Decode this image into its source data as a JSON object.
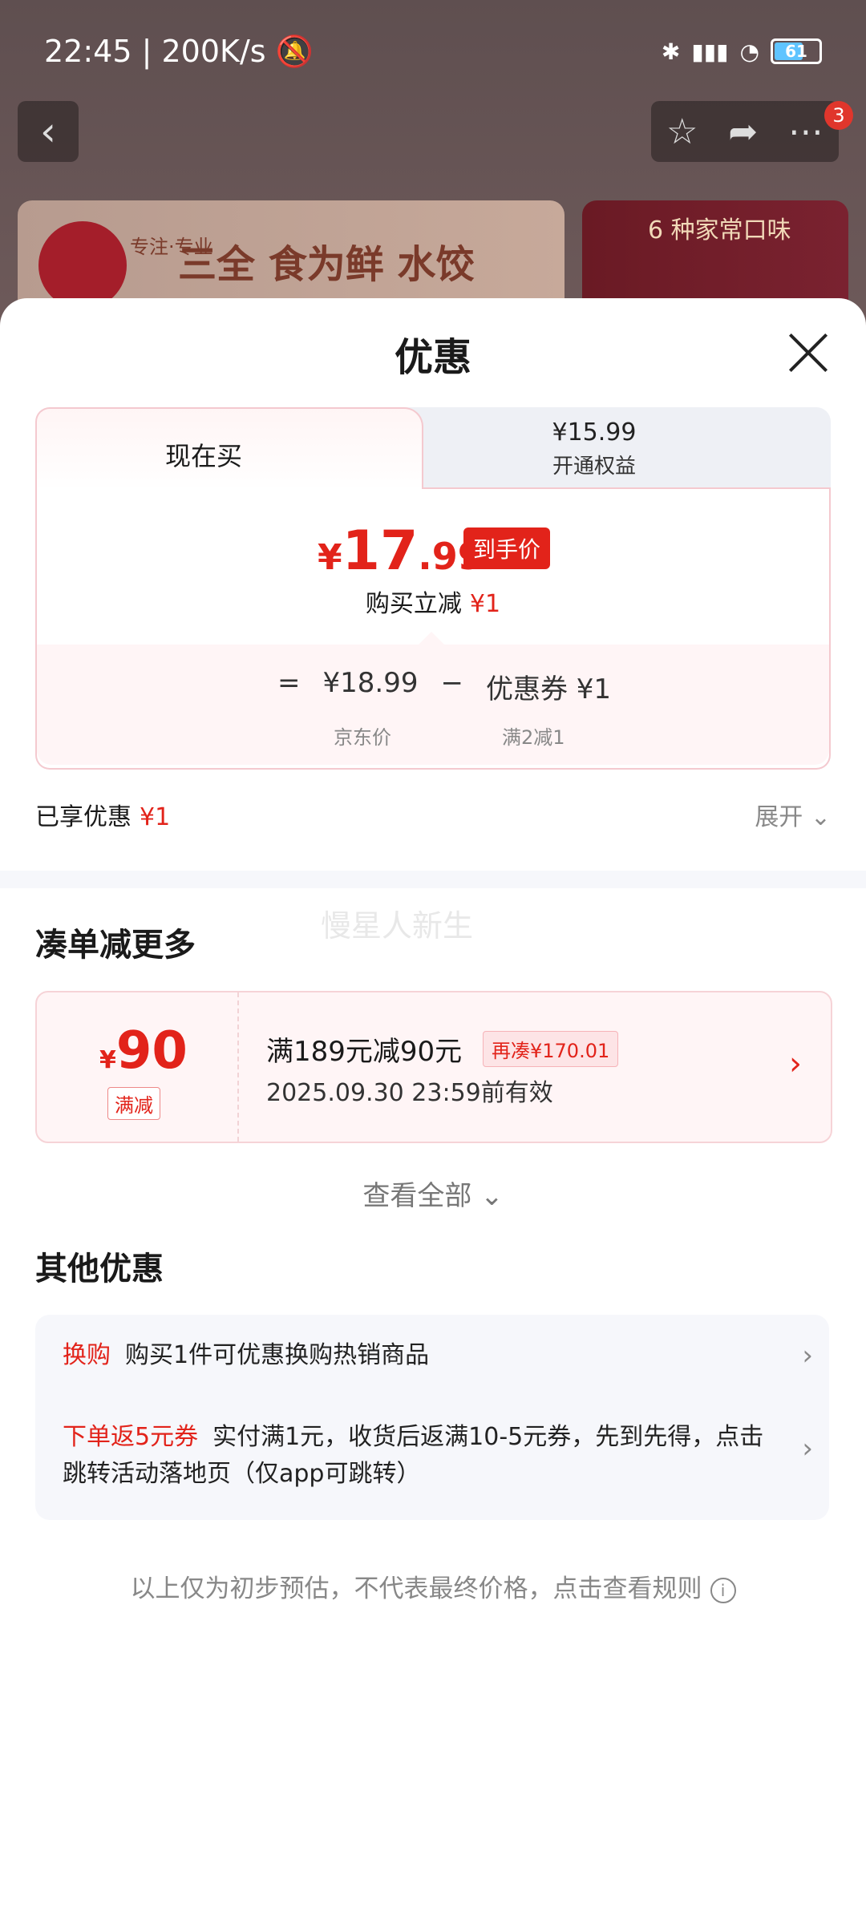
{
  "status_bar": {
    "time": "22:45",
    "speed": "200K/s",
    "battery": "61"
  },
  "background": {
    "banner1_text": "三全 食为鲜 水饺",
    "banner1_brand": "专注·专业",
    "banner2_text": "6 种家常口味",
    "nav_badge": "3"
  },
  "sheet": {
    "title": "优惠",
    "tab_now": "现在买",
    "tab_member_price": "¥15.99",
    "tab_member_label": "开通权益",
    "final_price_symbol": "¥",
    "final_price_int": "17",
    "final_price_dec": ".99",
    "final_price_tag": "到手价",
    "reduce_label": "购买立减",
    "reduce_value": "¥1",
    "calc_equals": "=",
    "calc_jd_price": "¥18.99",
    "calc_minus": "−",
    "calc_coupon": "优惠券 ¥1",
    "calc_jd_label": "京东价",
    "calc_coupon_label": "满2减1",
    "enjoyed_label": "已享优惠",
    "enjoyed_value": "¥1",
    "expand_label": "展开"
  },
  "more_section": {
    "title": "凑单减更多",
    "watermark": "慢星人新生",
    "coupon": {
      "symbol": "¥",
      "amount": "90",
      "type": "满减",
      "condition": "满189元减90元",
      "need_more": "再凑¥170.01",
      "valid": "2025.09.30 23:59前有效"
    },
    "view_all": "查看全部"
  },
  "other_section": {
    "title": "其他优惠",
    "rows": [
      {
        "tag": "换购",
        "text": "购买1件可优惠换购热销商品"
      },
      {
        "tag": "下单返5元券",
        "text": "实付满1元，收货后返满10-5元券，先到先得，点击跳转活动落地页（仅app可跳转）"
      }
    ]
  },
  "footnote": "以上仅为初步预估，不代表最终价格，点击查看规则",
  "colors": {
    "accent_red": "#e2231a",
    "sheet_bg": "#ffffff",
    "panel_bg": "#f6f7fb"
  }
}
